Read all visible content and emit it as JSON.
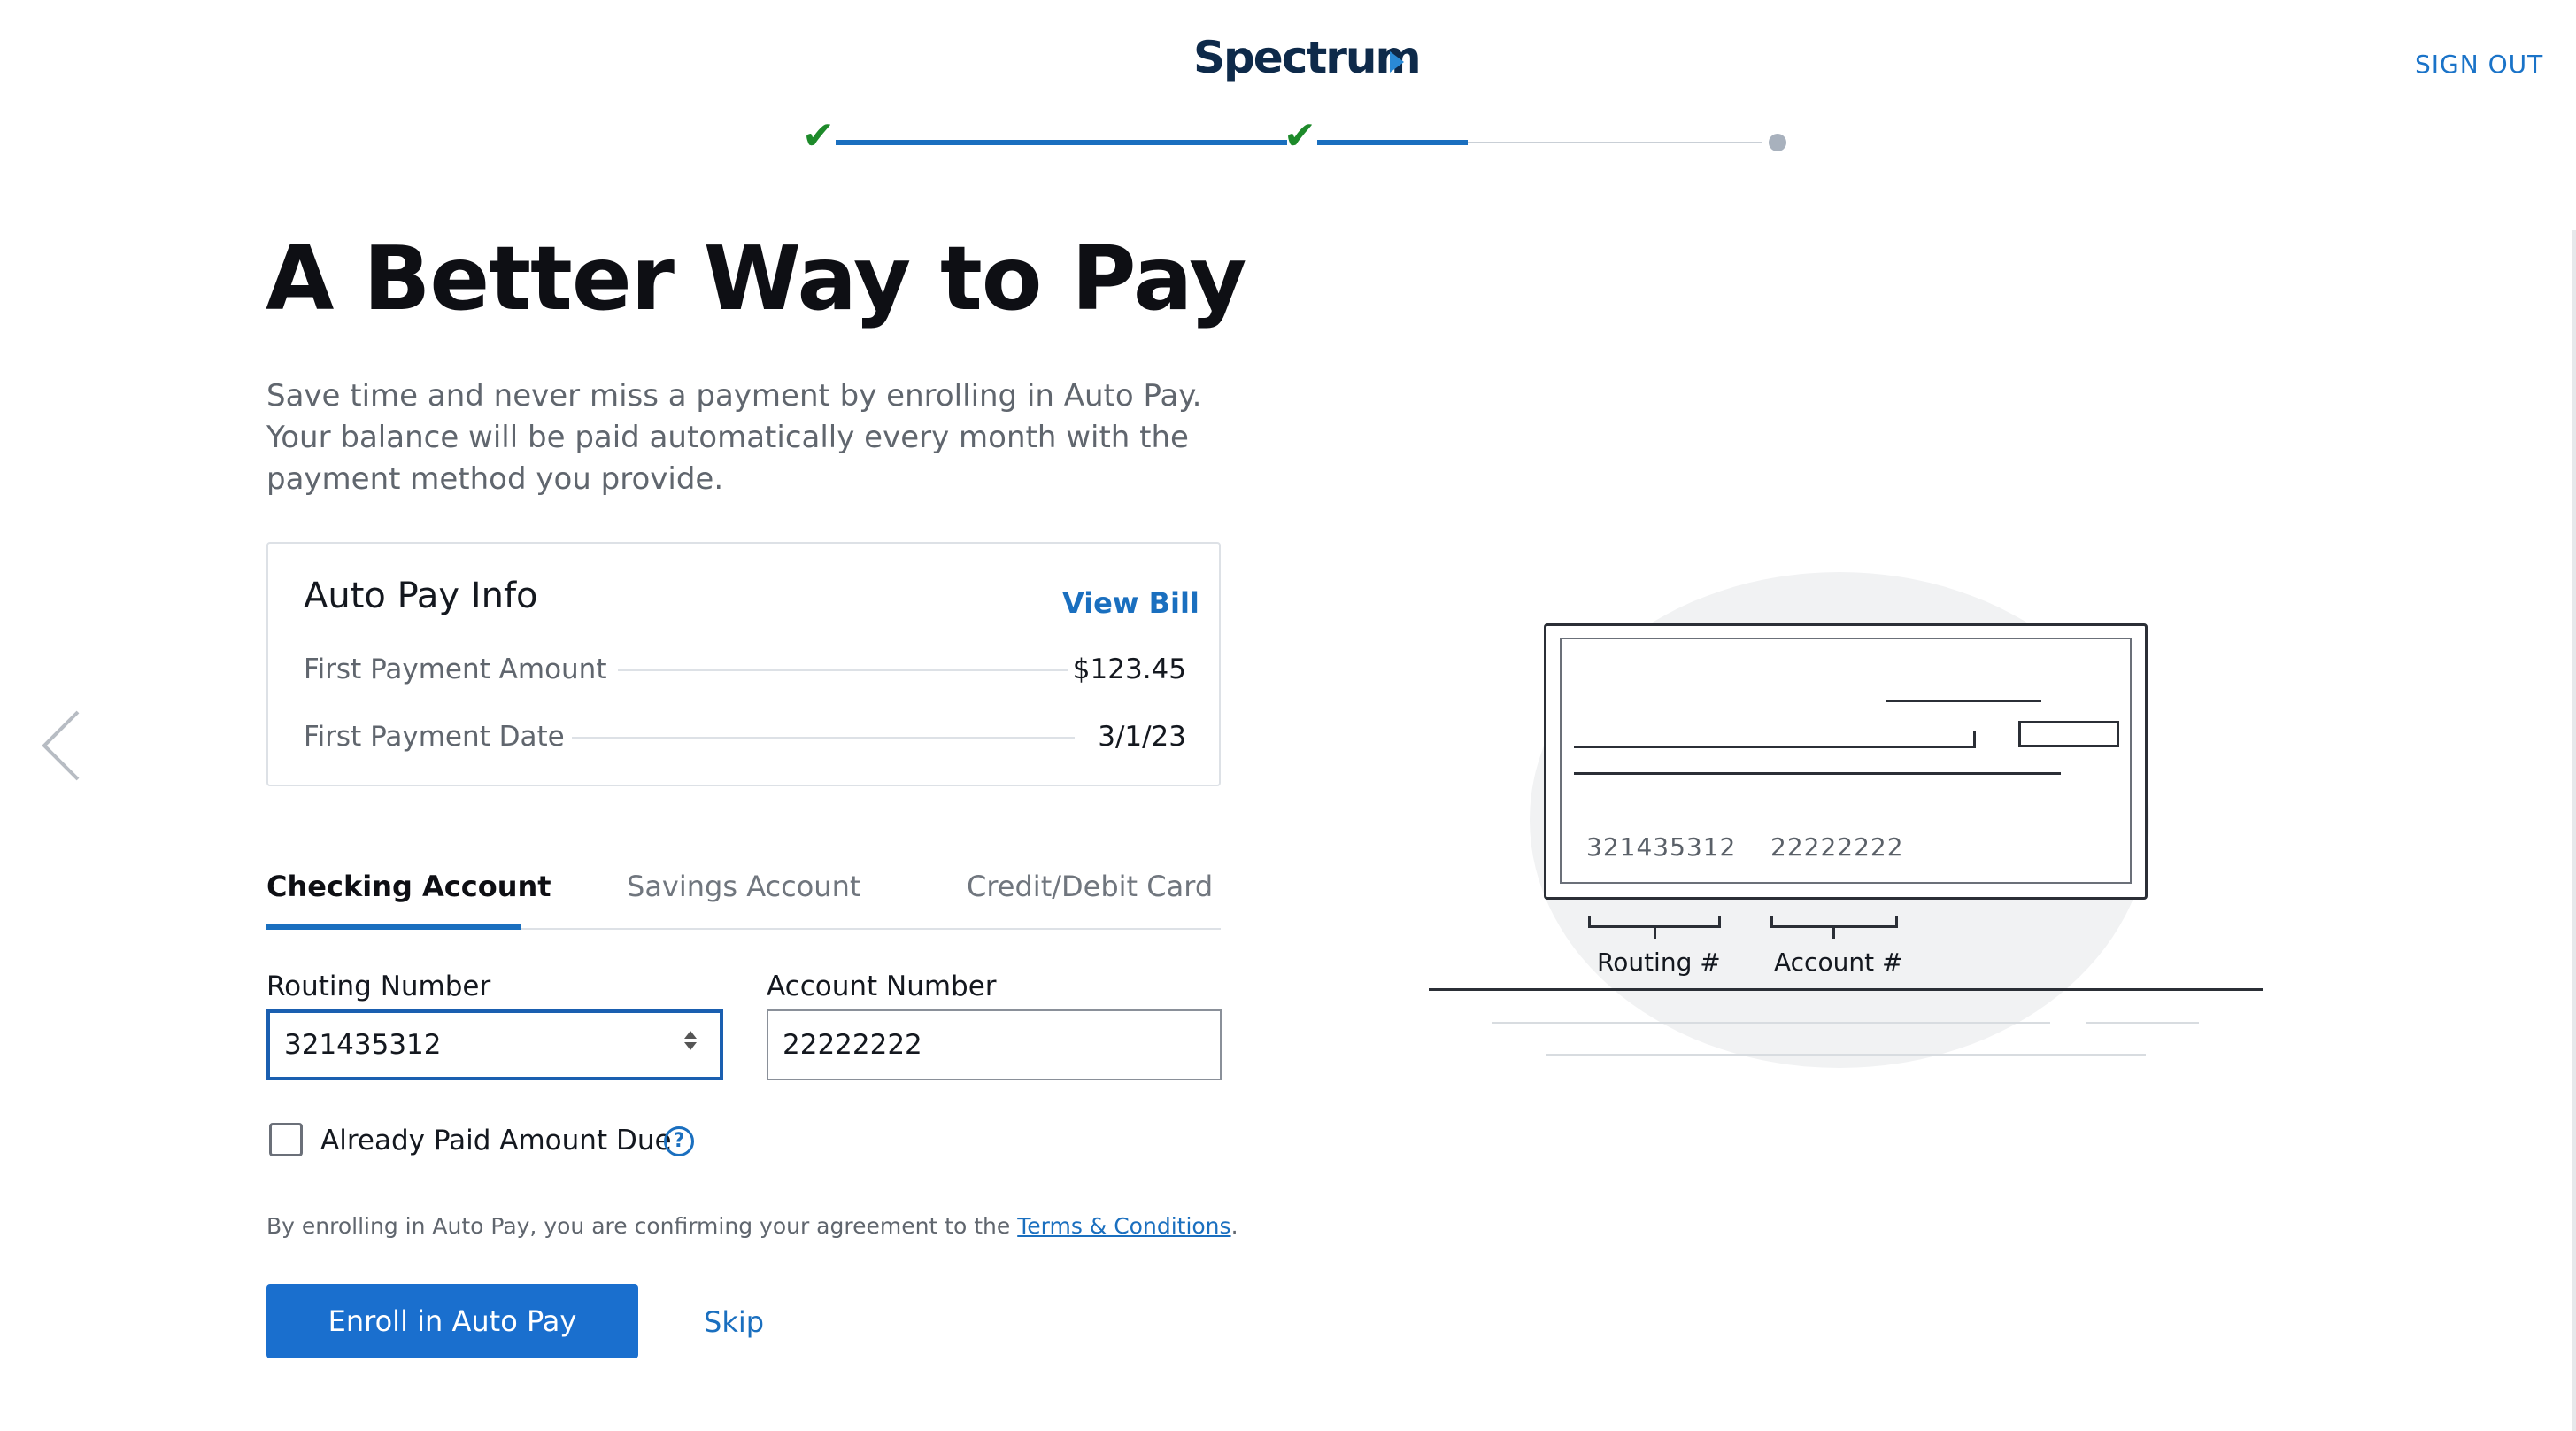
{
  "header": {
    "logo_text": "Spectrum",
    "sign_out_label": "SIGN OUT"
  },
  "progress": {
    "steps_total": 3,
    "steps_completed": 2
  },
  "main": {
    "title": "A Better Way to Pay",
    "description": "Save time and never miss a payment by enrolling in Auto Pay. Your balance will be paid automatically every month with the payment method you provide.",
    "auto_pay_info": {
      "title": "Auto Pay Info",
      "view_bill_label": "View Bill",
      "rows": [
        {
          "label": "First Payment Amount",
          "value": "$123.45"
        },
        {
          "label": "First Payment Date",
          "value": "3/1/23"
        }
      ]
    },
    "tabs": [
      {
        "label": "Checking Account",
        "active": true
      },
      {
        "label": "Savings Account",
        "active": false
      },
      {
        "label": "Credit/Debit Card",
        "active": false
      }
    ],
    "routing": {
      "label": "Routing Number",
      "value": "321435312"
    },
    "account": {
      "label": "Account Number",
      "value": "22222222"
    },
    "already_paid": {
      "label": "Already Paid Amount Due",
      "checked": false
    },
    "legal_text": "By enrolling in Auto Pay, you are confirming your agreement to the ",
    "terms_link": "Terms & Conditions",
    "legal_end": ".",
    "enroll_label": "Enroll in Auto Pay",
    "skip_label": "Skip"
  },
  "illustration": {
    "routing_number": "321435312",
    "account_number": "22222222",
    "routing_label": "Routing #",
    "account_label": "Account #"
  },
  "colors": {
    "accent": "#1a6fce",
    "check_green": "#1d8a2a"
  }
}
